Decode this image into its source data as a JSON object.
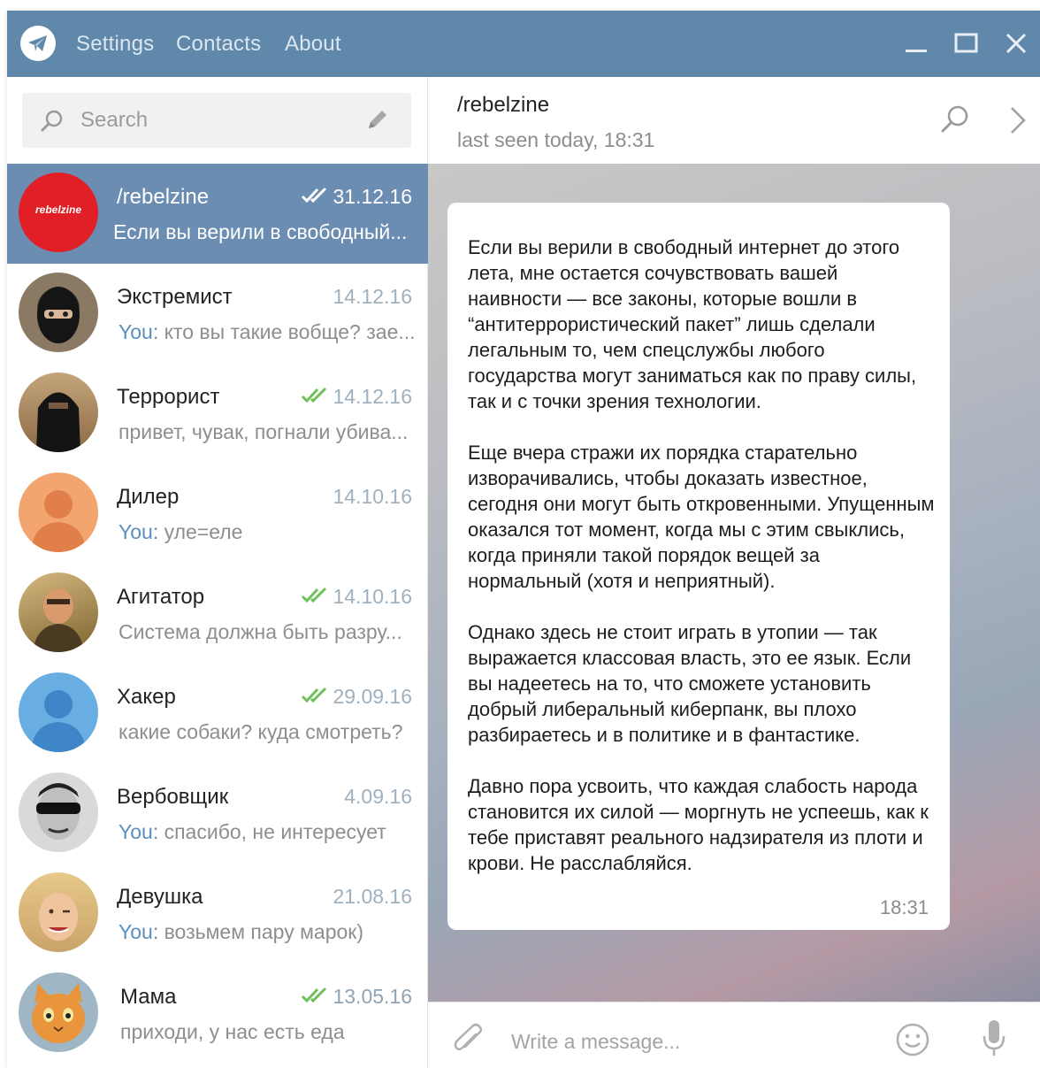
{
  "app": {
    "menu": [
      "Settings",
      "Contacts",
      "About"
    ]
  },
  "sidebar": {
    "search_placeholder": "Search",
    "chats": [
      {
        "name": "/rebelzine",
        "date": "31.12.16",
        "prefix": "",
        "preview": "Если вы верили в свободный...",
        "read": true,
        "active": true,
        "avatar_text": "rebelzine"
      },
      {
        "name": "Экстремист",
        "date": "14.12.16",
        "prefix": "You:",
        "preview": "кто вы такие вобще? зае...",
        "read": false
      },
      {
        "name": "Террорист",
        "date": "14.12.16",
        "prefix": "",
        "preview": "привет, чувак, погнали убива...",
        "read": true
      },
      {
        "name": "Дилер",
        "date": "14.10.16",
        "prefix": "You:",
        "preview": "уле=еле",
        "read": false
      },
      {
        "name": "Агитатор",
        "date": "14.10.16",
        "prefix": "",
        "preview": "Система должна быть разру...",
        "read": true
      },
      {
        "name": "Хакер",
        "date": "29.09.16",
        "prefix": "",
        "preview": "какие собаки? куда смотреть?",
        "read": true
      },
      {
        "name": "Вербовщик",
        "date": "4.09.16",
        "prefix": "You:",
        "preview": "спасибо, не интересует",
        "read": false
      },
      {
        "name": "Девушка",
        "date": "21.08.16",
        "prefix": "You:",
        "preview": "возьмем пару марок)",
        "read": false
      },
      {
        "name": "Мама",
        "date": "13.05.16",
        "prefix": "",
        "preview": "приходи, у нас есть еда",
        "read": true
      }
    ]
  },
  "chat": {
    "peer_name": "/rebelzine",
    "status": "last seen today, 18:31",
    "message": {
      "text": "Если вы верили в свободный интернет до этого лета, мне остается сочувствовать вашей наивности — все законы, которые вошли в “антитеррористический пакет” лишь сделали легальным то, чем спецслужбы любого государства могут заниматься как по праву силы, так и с точки зрения технологии.\n\nЕще вчера стражи их порядка старательно изворачивались, чтобы доказать известное, сегодня они могут быть откровенными. Упущенным оказался тот момент, когда мы с этим свыклись, когда приняли такой порядок вещей за нормальный (хотя и неприятный).\n\nОднако здесь не стоит играть в утопии — так выражается классовая власть, это ее язык. Если вы надеетесь на то, что сможете установить добрый либеральный киберпанк, вы плохо разбираетесь и в политике и в фантастике.\n\nДавно пора усвоить, что каждая слабость народа становится их силой — моргнуть не успеешь, как к тебе приставят реального надзирателя из плоти и крови. Не расслабляйся.",
      "time": "18:31"
    },
    "composer_placeholder": "Write a message..."
  },
  "colors": {
    "titlebar": "#5f88ab",
    "active_chat": "#6a8db1",
    "read_tick": "#6fbf5a",
    "you_prefix": "#5b8fbf"
  }
}
